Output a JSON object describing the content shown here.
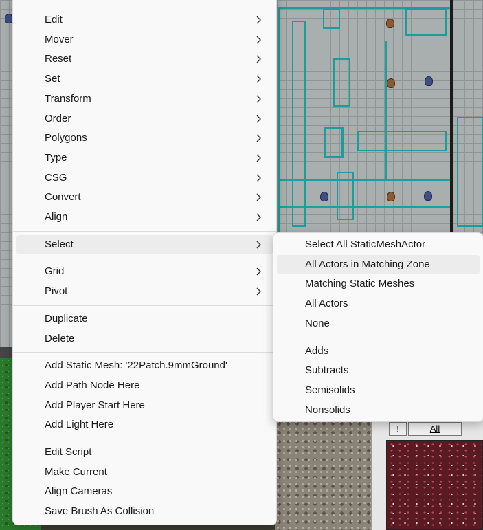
{
  "menu": {
    "groups": [
      [
        {
          "label": "Edit",
          "submenu": true
        },
        {
          "label": "Mover",
          "submenu": true
        },
        {
          "label": "Reset",
          "submenu": true
        },
        {
          "label": "Set",
          "submenu": true
        },
        {
          "label": "Transform",
          "submenu": true
        },
        {
          "label": "Order",
          "submenu": true
        },
        {
          "label": "Polygons",
          "submenu": true
        },
        {
          "label": "Type",
          "submenu": true
        },
        {
          "label": "CSG",
          "submenu": true
        },
        {
          "label": "Convert",
          "submenu": true
        },
        {
          "label": "Align",
          "submenu": true
        }
      ],
      [
        {
          "label": "Select",
          "submenu": true,
          "highlighted": true
        }
      ],
      [
        {
          "label": "Grid",
          "submenu": true
        },
        {
          "label": "Pivot",
          "submenu": true
        }
      ],
      [
        {
          "label": "Duplicate",
          "submenu": false
        },
        {
          "label": "Delete",
          "submenu": false
        }
      ],
      [
        {
          "label": "Add Static Mesh: '22Patch.9mmGround'",
          "submenu": false
        },
        {
          "label": "Add Path Node Here",
          "submenu": false
        },
        {
          "label": "Add Player Start Here",
          "submenu": false
        },
        {
          "label": "Add Light Here",
          "submenu": false
        }
      ],
      [
        {
          "label": "Edit Script",
          "submenu": false
        },
        {
          "label": "Make Current",
          "submenu": false
        },
        {
          "label": "Align Cameras",
          "submenu": false
        },
        {
          "label": "Save Brush As Collision",
          "submenu": false
        }
      ]
    ]
  },
  "submenu": {
    "groups": [
      [
        {
          "label": "Select All StaticMeshActor"
        },
        {
          "label": "All Actors in Matching Zone",
          "highlighted": true
        },
        {
          "label": "Matching Static Meshes"
        },
        {
          "label": "All Actors"
        },
        {
          "label": "None"
        }
      ],
      [
        {
          "label": "Adds"
        },
        {
          "label": "Subtracts"
        },
        {
          "label": "Semisolids"
        },
        {
          "label": "Nonsolids"
        }
      ]
    ]
  },
  "panel": {
    "buttons": [
      "!",
      "All"
    ]
  },
  "icons": {
    "submenu_arrow": "chevron-right-icon"
  },
  "colors": {
    "menu_bg": "#f9f9f9",
    "highlight": "#ececec",
    "wireframe": "#1e9c9c",
    "viewport_bg": "#a9aeaf"
  }
}
